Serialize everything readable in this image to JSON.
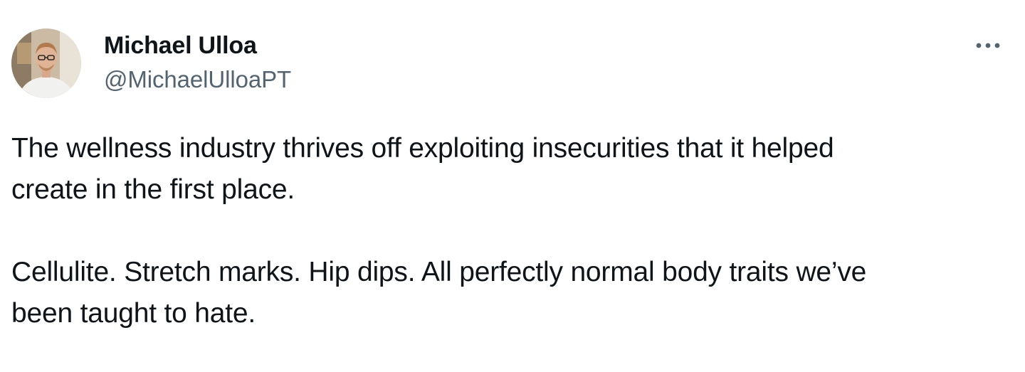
{
  "tweet": {
    "author": {
      "display_name": "Michael Ulloa",
      "handle": "@MichaelUlloaPT",
      "avatar_icon": "person-photo-avatar"
    },
    "more_icon": "more-horizontal-icon",
    "text": {
      "paragraph_1": {
        "line_1": "The wellness industry thrives off exploiting insecurities that it helped",
        "line_2": "create in the first place."
      },
      "paragraph_2": {
        "line_1": "Cellulite. Stretch marks. Hip dips. All perfectly normal body traits we’ve",
        "line_2": "been taught to hate."
      }
    }
  },
  "colors": {
    "text_primary": "#0f1419",
    "text_secondary": "#536471",
    "background": "#ffffff"
  }
}
